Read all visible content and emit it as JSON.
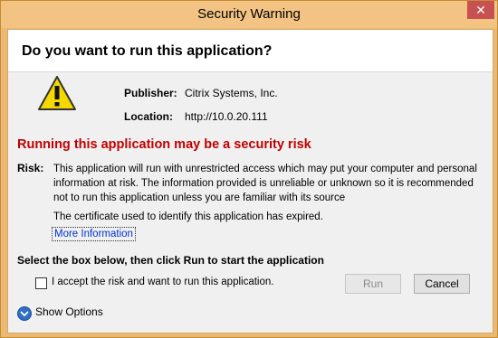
{
  "window": {
    "title": "Security Warning",
    "close_glyph": "✕"
  },
  "dialog": {
    "question": "Do you want to run this application?",
    "publisher_label": "Publisher:",
    "publisher_value": "Citrix Systems, Inc.",
    "location_label": "Location:",
    "location_value": "http://10.0.20.111",
    "risk_heading": "Running this application may be a security risk",
    "risk_label": "Risk:",
    "risk_text": "This application will run with unrestricted access which may put your computer and personal information at risk. The information provided is unreliable or unknown so it is recommended not to run this application unless you are familiar with its source",
    "cert_text": "The certificate used to identify this application has expired.",
    "more_info_link": "More Information",
    "instruction": "Select the box below, then click Run to start the application",
    "accept_label": "I accept the risk and want to run this application.",
    "accept_checked": false,
    "run_button": "Run",
    "run_enabled": false,
    "cancel_button": "Cancel",
    "show_options": "Show Options"
  },
  "icons": {
    "warning": "warning-triangle-icon",
    "close": "close-icon",
    "expand": "chevron-down-icon"
  },
  "colors": {
    "title_bar": "#f3c384",
    "close_button": "#c75050",
    "risk_heading": "#c00000",
    "link": "#0033cc",
    "expand_icon": "#2f6fc6"
  }
}
